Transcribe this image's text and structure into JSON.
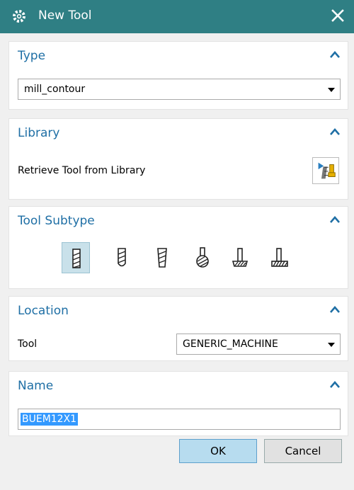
{
  "window": {
    "title": "New Tool"
  },
  "type_section": {
    "title": "Type",
    "select_value": "mill_contour"
  },
  "library_section": {
    "title": "Library",
    "retrieve_label": "Retrieve Tool from Library"
  },
  "subtype_section": {
    "title": "Tool Subtype",
    "icons": [
      "mill-icon",
      "ball-mill-icon",
      "chamfer-mill-icon",
      "spherical-mill-icon",
      "t-cutter-icon",
      "barrel-cutter-icon"
    ]
  },
  "location_section": {
    "title": "Location",
    "tool_label": "Tool",
    "tool_value": "GENERIC_MACHINE"
  },
  "name_section": {
    "title": "Name",
    "name_value": "BUEM12X1"
  },
  "buttons": {
    "ok": "OK",
    "cancel": "Cancel"
  },
  "colors": {
    "titlebar": "#2f7f84",
    "section_title": "#1f6fa5",
    "selection": "#3399ff"
  }
}
